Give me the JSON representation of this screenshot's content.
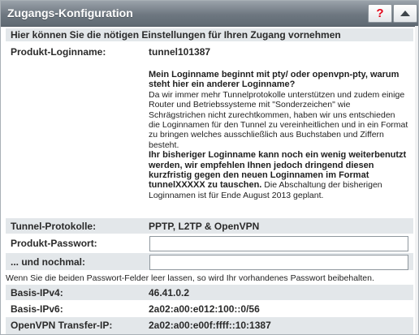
{
  "panel": {
    "title": "Zugangs-Konfiguration",
    "help_icon": "?",
    "collapse_icon": "chevron-up-icon"
  },
  "intro": "Hier können Sie die nötigen Einstellungen für Ihren Zugang vornehmen",
  "login": {
    "label": "Produkt-Loginname:",
    "value": "tunnel101387",
    "q_title": "Mein Loginname beginnt mit pty/ oder openvpn-pty, warum steht hier ein anderer Loginname?",
    "q_text": "Da wir immer mehr Tunnelprotokolle unterstützen und zudem einige Router und Betriebssysteme mit \"Sonderzeichen\" wie Schrägstrichen nicht zurechtkommen, haben wir uns entschieden die Loginnamen für den Tunnel zu vereinheitlichen und in ein Format zu bringen welches ausschließlich aus Buchstaben und Ziffern besteht.",
    "warn": "Ihr bisheriger Loginname kann noch ein wenig weiterbenutzt werden, wir empfehlen Ihnen jedoch dringend diesen kurzfristig gegen den neuen Loginnamen im Format tunnelXXXXX zu tauschen.",
    "tail": "Die Abschaltung der bisherigen Loginnamen ist für Ende August 2013 geplant."
  },
  "protocols": {
    "label": "Tunnel-Protokolle:",
    "value": "PPTP, L2TP & OpenVPN"
  },
  "password": {
    "label": "Produkt-Passwort:",
    "value": "",
    "placeholder": ""
  },
  "password_repeat": {
    "label": "... und nochmal:",
    "value": "",
    "placeholder": ""
  },
  "password_hint": "Wenn Sie die beiden Passwort-Felder leer lassen, so wird Ihr vorhandenes Passwort beibehalten.",
  "ipv4": {
    "label": "Basis-IPv4:",
    "value": "46.41.0.2"
  },
  "ipv6": {
    "label": "Basis-IPv6:",
    "value": "2a02:a00:e012:100::0/56"
  },
  "openvpn": {
    "label": "OpenVPN Transfer-IP:",
    "value": "2a02:a00:e00f:ffff::10:1387"
  }
}
